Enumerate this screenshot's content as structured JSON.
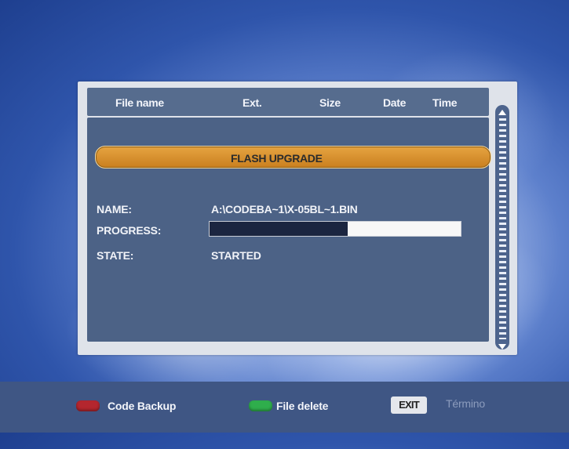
{
  "columns": {
    "file_name": "File name",
    "ext": "Ext.",
    "size": "Size",
    "date": "Date",
    "time": "Time"
  },
  "dialog": {
    "title": "FLASH UPGRADE",
    "name_label": "NAME:",
    "name_value": "A:\\CODEBA~1\\X-05BL~1.BIN",
    "progress_label": "PROGRESS:",
    "progress_fraction": 0.55,
    "state_label": "STATE:",
    "state_value": "STARTED"
  },
  "footer": {
    "red_key_label": "Code Backup",
    "green_key_label": "File delete",
    "exit_key": "EXIT",
    "exit_label": "Término"
  },
  "colors": {
    "header_bg": "#566c8e",
    "panel_body_bg": "#4c6286",
    "title_bar": "#d58e2c",
    "progress_fill": "#1b2540",
    "red_key": "#b4262e",
    "green_key": "#2fae4c"
  },
  "icons": {
    "scroll_up": "triangle-up-icon",
    "scroll_down": "triangle-down-icon"
  }
}
